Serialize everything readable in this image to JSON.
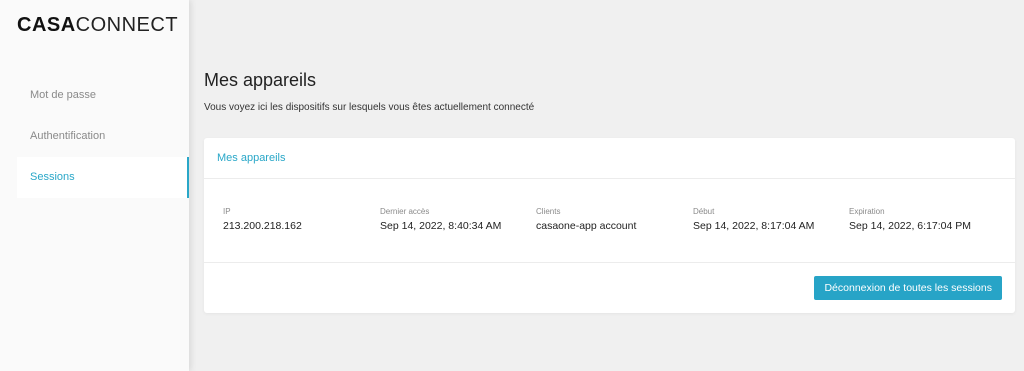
{
  "brand": {
    "bold": "CASA",
    "light": "CONNECT"
  },
  "sidebar": {
    "items": [
      {
        "label": "Mot de passe"
      },
      {
        "label": "Authentification"
      },
      {
        "label": "Sessions"
      }
    ],
    "active_index": 2
  },
  "page": {
    "title": "Mes appareils",
    "subtitle": "Vous voyez ici les dispositifs sur lesquels vous êtes actuellement connecté"
  },
  "card": {
    "header": "Mes appareils",
    "columns": {
      "ip": "IP",
      "last_access": "Dernier accès",
      "clients": "Clients",
      "start": "Début",
      "expiration": "Expiration"
    },
    "sessions": [
      {
        "ip": "213.200.218.162",
        "last_access": "Sep 14, 2022, 8:40:34 AM",
        "clients": "casaone-app account",
        "start": "Sep 14, 2022, 8:17:04 AM",
        "expiration": "Sep 14, 2022, 6:17:04 PM"
      }
    ],
    "logout_all_label": "Déconnexion de toutes les sessions"
  },
  "colors": {
    "accent": "#29a7c8",
    "button": "#27a4c7",
    "background": "#f0f0f0"
  }
}
